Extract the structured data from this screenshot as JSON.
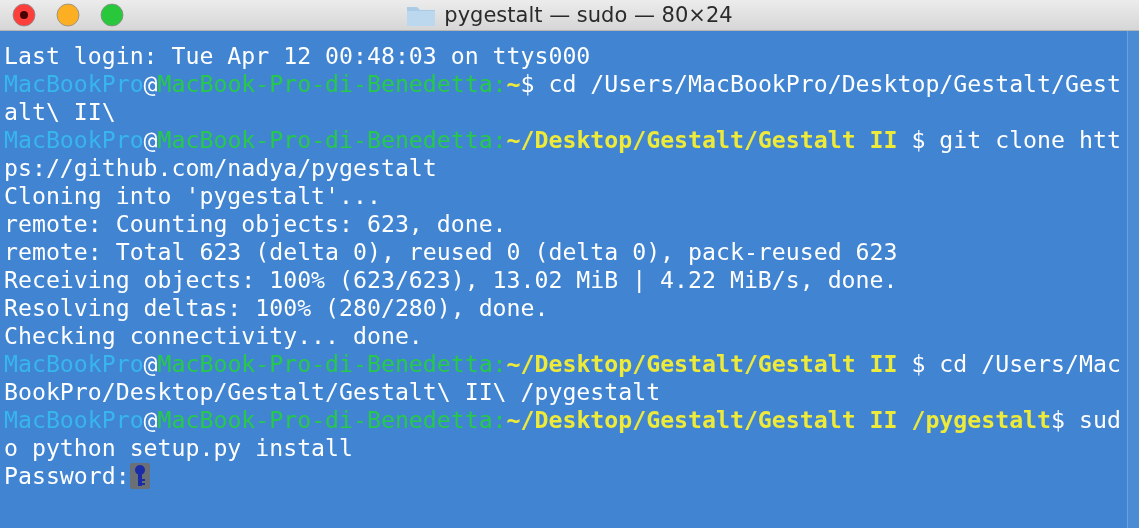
{
  "window": {
    "title": "pygestalt — sudo — 80×24"
  },
  "terminal": {
    "lines": [
      [
        {
          "kind": "plain",
          "text": "Last login: Tue Apr 12 00:48:03 on ttys000"
        }
      ],
      [
        {
          "kind": "user",
          "text": "MacBookPro"
        },
        {
          "kind": "plain",
          "text": "@"
        },
        {
          "kind": "host",
          "text": "MacBook-Pro-di-Benedetta:"
        },
        {
          "kind": "path",
          "text": "~"
        },
        {
          "kind": "plain",
          "text": "$ cd /Users/MacBookPro/Desktop/Gestalt/Gest"
        }
      ],
      [
        {
          "kind": "plain",
          "text": "alt\\ II\\"
        }
      ],
      [
        {
          "kind": "user",
          "text": "MacBookPro"
        },
        {
          "kind": "plain",
          "text": "@"
        },
        {
          "kind": "host",
          "text": "MacBook-Pro-di-Benedetta:"
        },
        {
          "kind": "path",
          "text": "~/Desktop/Gestalt/Gestalt II"
        },
        {
          "kind": "plain",
          "text": " $ git clone htt"
        }
      ],
      [
        {
          "kind": "plain",
          "text": "ps://github.com/nadya/pygestalt"
        }
      ],
      [
        {
          "kind": "plain",
          "text": "Cloning into 'pygestalt'..."
        }
      ],
      [
        {
          "kind": "plain",
          "text": "remote: Counting objects: 623, done."
        }
      ],
      [
        {
          "kind": "plain",
          "text": "remote: Total 623 (delta 0), reused 0 (delta 0), pack-reused 623"
        }
      ],
      [
        {
          "kind": "plain",
          "text": "Receiving objects: 100% (623/623), 13.02 MiB | 4.22 MiB/s, done."
        }
      ],
      [
        {
          "kind": "plain",
          "text": "Resolving deltas: 100% (280/280), done."
        }
      ],
      [
        {
          "kind": "plain",
          "text": "Checking connectivity... done."
        }
      ],
      [
        {
          "kind": "user",
          "text": "MacBookPro"
        },
        {
          "kind": "plain",
          "text": "@"
        },
        {
          "kind": "host",
          "text": "MacBook-Pro-di-Benedetta:"
        },
        {
          "kind": "path",
          "text": "~/Desktop/Gestalt/Gestalt II"
        },
        {
          "kind": "plain",
          "text": " $ cd /Users/Mac"
        }
      ],
      [
        {
          "kind": "plain",
          "text": "BookPro/Desktop/Gestalt/Gestalt\\ II\\ /pygestalt"
        }
      ],
      [
        {
          "kind": "user",
          "text": "MacBookPro"
        },
        {
          "kind": "plain",
          "text": "@"
        },
        {
          "kind": "host",
          "text": "MacBook-Pro-di-Benedetta:"
        },
        {
          "kind": "path",
          "text": "~/Desktop/Gestalt/Gestalt II /pygestalt"
        },
        {
          "kind": "plain",
          "text": "$ sud"
        }
      ],
      [
        {
          "kind": "plain",
          "text": "o python setup.py install"
        }
      ],
      [
        {
          "kind": "plain",
          "text": "Password:"
        },
        {
          "kind": "cursor"
        }
      ]
    ]
  }
}
